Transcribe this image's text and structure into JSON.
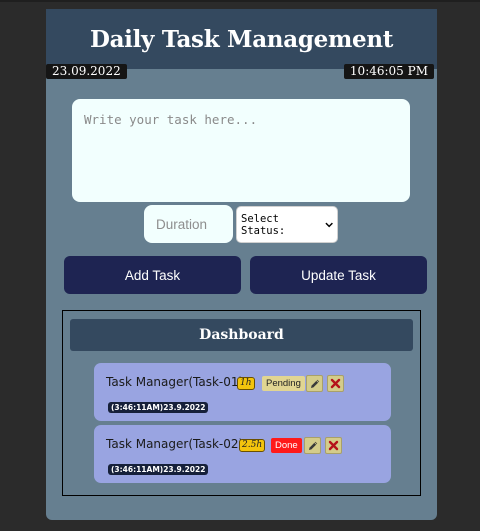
{
  "app": {
    "title": "Daily Task Management",
    "date": "23.09.2022",
    "time": "10:46:05 PM"
  },
  "form": {
    "task_placeholder": "Write your task here...",
    "duration_placeholder": "Duration",
    "status_select_value": "Select Status:",
    "add_label": "Add Task",
    "update_label": "Update Task"
  },
  "dashboard": {
    "title": "Dashboard",
    "tasks": [
      {
        "name": "Task Manager(Task-01)",
        "duration": "1h",
        "status": "Pending",
        "timestamp": "(3:46:11AM)23.9.2022"
      },
      {
        "name": "Task Manager(Task-02)",
        "duration": "2.5h",
        "status": "Done",
        "timestamp": "(3:46:11AM)23.9.2022"
      }
    ]
  },
  "icons": {
    "edit": "pencil-icon",
    "delete": "cross-icon"
  },
  "colors": {
    "background": "#2b2b2b",
    "panel": "#667f90",
    "header": "#34495f",
    "button": "#1e2452",
    "card": "#99a4e1",
    "duration_badge": "#f3c40d",
    "pending": "#e1d592",
    "done": "#ff1a1a"
  }
}
